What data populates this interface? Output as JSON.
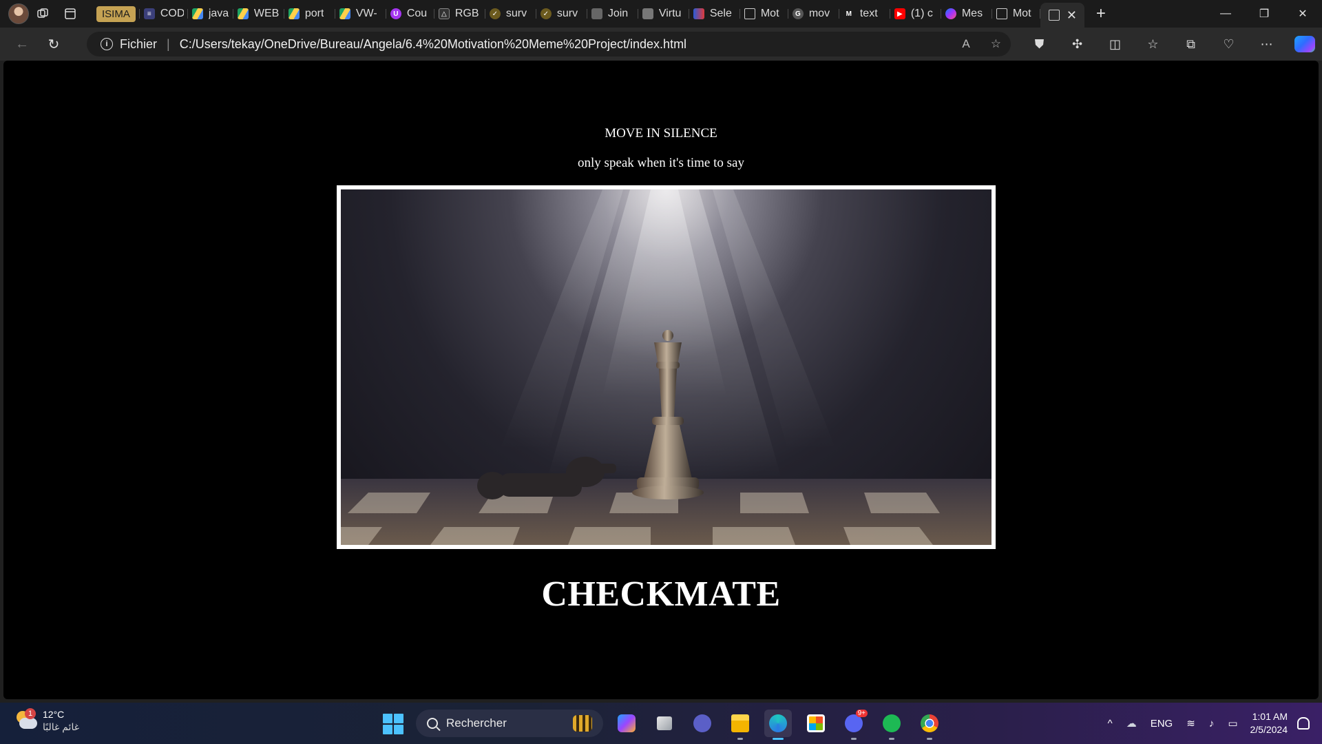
{
  "colors": {
    "tabstrip_bg": "#1b1b1b",
    "toolbar_bg": "#2b2b2b",
    "page_bg": "#000000",
    "page_text": "#ffffff",
    "group_chip": "#c5a253",
    "start_blue": "#4cc2ff"
  },
  "tabstrip": {
    "group_label": "ISIMA",
    "tabs": [
      {
        "label": "COD",
        "icon": "list-icon"
      },
      {
        "label": "java",
        "icon": "drive-icon"
      },
      {
        "label": "WEB",
        "icon": "drive-icon"
      },
      {
        "label": "port",
        "icon": "drive-icon"
      },
      {
        "label": "VW-",
        "icon": "drive-icon"
      },
      {
        "label": "Cou",
        "icon": "udemy-icon"
      },
      {
        "label": "RGB",
        "icon": "diagram-icon"
      },
      {
        "label": "surv",
        "icon": "survey-icon"
      },
      {
        "label": "surv",
        "icon": "survey-icon"
      },
      {
        "label": "Join",
        "icon": "site-icon"
      },
      {
        "label": "Virtu",
        "icon": "site-icon"
      },
      {
        "label": "Sele",
        "icon": "site-icon"
      },
      {
        "label": "Mot",
        "icon": "page-icon"
      },
      {
        "label": "mov",
        "icon": "google-icon"
      },
      {
        "label": "text",
        "icon": "m-icon"
      },
      {
        "label": "(1) c",
        "icon": "youtube-icon"
      },
      {
        "label": "Mes",
        "icon": "messenger-icon"
      },
      {
        "label": "Mot",
        "icon": "page-icon"
      }
    ],
    "active_tab_icon": "page-icon",
    "new_tab_glyph": "+",
    "window": {
      "minimize": "—",
      "restore": "❐",
      "close": "✕"
    }
  },
  "toolbar": {
    "back_glyph": "←",
    "reload_glyph": "↻",
    "scheme_label": "Fichier",
    "url": "C:/Users/tekay/OneDrive/Bureau/Angela/6.4%20Motivation%20Meme%20Project/index.html",
    "read_aloud_glyph": "A",
    "favorite_glyph": "☆",
    "ext_glyphs": [
      "⛊",
      "✣",
      "◫",
      "☆",
      "⧉",
      "♡",
      "⋯"
    ]
  },
  "page": {
    "heading": "MOVE IN SILENCE",
    "subheading": "only speak when it's time to say",
    "image_alt": "chess-queen-spotlight",
    "title": "CHECKMATE"
  },
  "taskbar": {
    "weather_temp": "12°C",
    "weather_desc": "غائم غالبًا",
    "weather_badge": "1",
    "search_placeholder": "Rechercher",
    "discord_badge": "9+",
    "language": "ENG",
    "time": "1:01 AM",
    "date": "2/5/2024"
  }
}
